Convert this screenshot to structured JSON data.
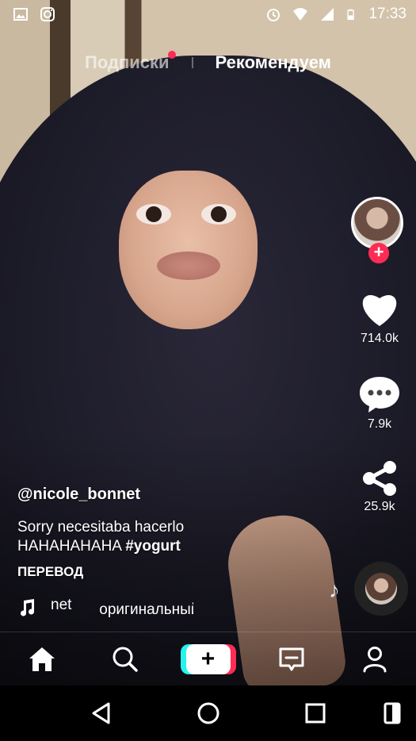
{
  "status_bar": {
    "time": "17:33",
    "left_icons": [
      "image-icon",
      "instagram-icon"
    ],
    "right_icons": [
      "alarm-icon",
      "wifi-icon",
      "signal-icon",
      "battery-icon"
    ]
  },
  "top_tabs": [
    {
      "label": "Подписки",
      "active": false,
      "has_notification_dot": true
    },
    {
      "label": "Рекомендуем",
      "active": true
    }
  ],
  "creator": {
    "username": "@nicole_bonnet",
    "caption_line1": "Sorry necesitaba hacerlo",
    "caption_line2_text": "HAHAHAHAHA",
    "caption_hashtag": "#yogurt",
    "translate_label": "ПЕРЕВОД",
    "sound_text_fragment": "net",
    "sound_text_main": "оригинальный звук"
  },
  "actions": {
    "likes": "714.0k",
    "comments": "7.9k",
    "shares": "25.9k"
  },
  "bottom_nav": [
    {
      "name": "home",
      "icon": "home-icon"
    },
    {
      "name": "discover",
      "icon": "search-icon"
    },
    {
      "name": "create",
      "icon": "plus-icon",
      "label": "+"
    },
    {
      "name": "inbox",
      "icon": "inbox-icon"
    },
    {
      "name": "profile",
      "icon": "profile-icon"
    }
  ],
  "colors": {
    "accent_red": "#fe2c55",
    "accent_cyan": "#25f4ee"
  }
}
